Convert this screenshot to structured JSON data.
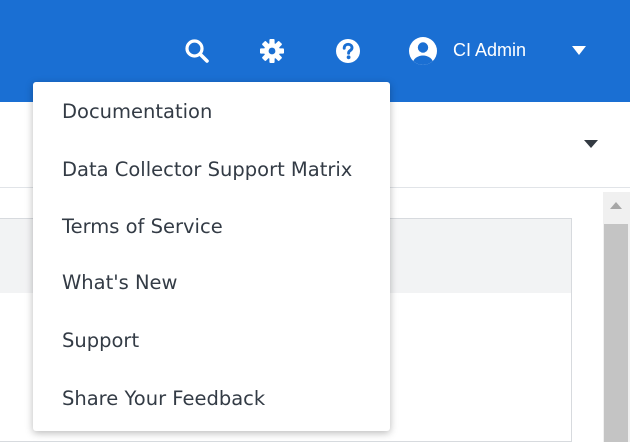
{
  "header": {
    "background_color": "#1a6fd3",
    "icons": [
      "search-icon",
      "gear-icon",
      "help-icon",
      "user-icon",
      "chevron-down-icon"
    ],
    "user_name": "CI Admin"
  },
  "help_menu": {
    "items": [
      {
        "label": "Documentation"
      },
      {
        "label": "Data Collector Support Matrix"
      },
      {
        "label": "Terms of Service"
      },
      {
        "label": "What's New"
      },
      {
        "label": "Support"
      },
      {
        "label": "Share Your Feedback"
      }
    ]
  }
}
